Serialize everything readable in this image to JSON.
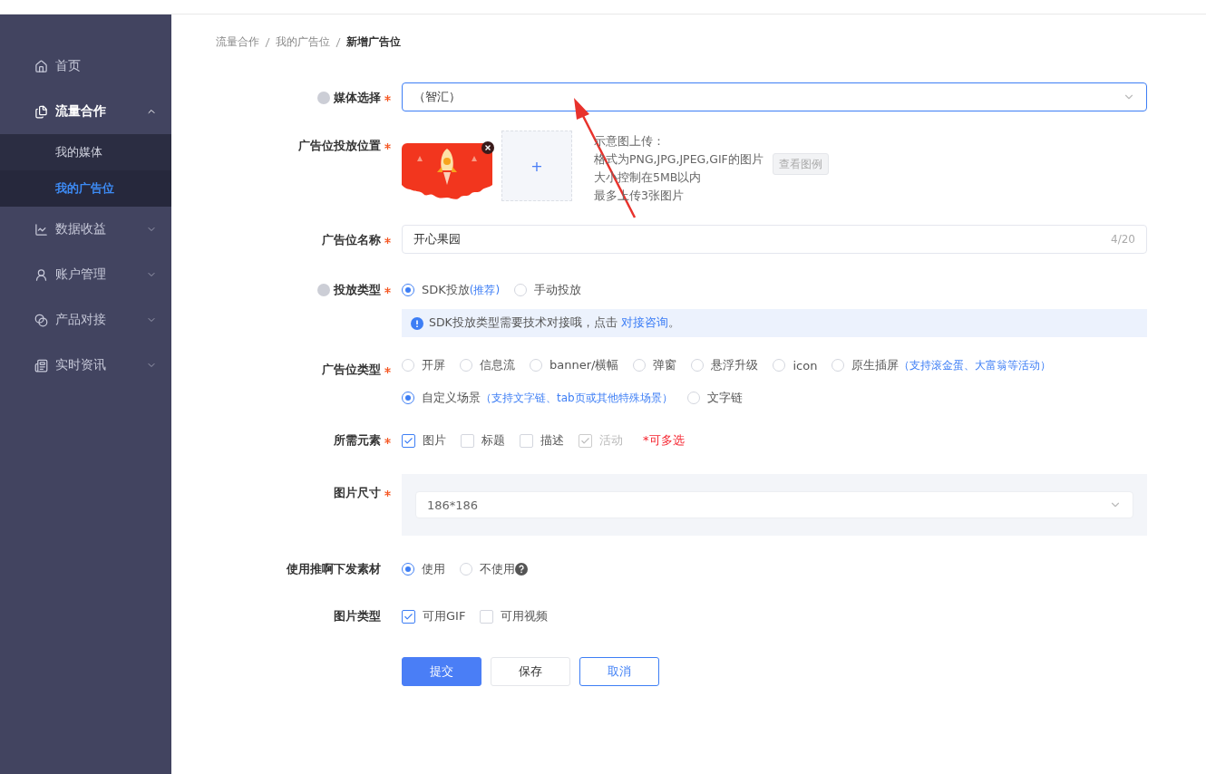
{
  "sidebar": {
    "items": [
      {
        "label": "首页",
        "kind": "link"
      },
      {
        "label": "流量合作",
        "kind": "group",
        "expanded": true,
        "children": [
          {
            "label": "我的媒体",
            "selected": false
          },
          {
            "label": "我的广告位",
            "selected": true
          }
        ]
      },
      {
        "label": "数据收益",
        "kind": "group",
        "expanded": false
      },
      {
        "label": "账户管理",
        "kind": "group",
        "expanded": false
      },
      {
        "label": "产品对接",
        "kind": "group",
        "expanded": false
      },
      {
        "label": "实时资讯",
        "kind": "group",
        "expanded": false
      }
    ]
  },
  "breadcrumb": [
    {
      "label": "流量合作",
      "current": false
    },
    {
      "label": "我的广告位",
      "current": false
    },
    {
      "label": "新增广告位",
      "current": true
    }
  ],
  "form": {
    "fields": [
      {
        "kind": "select",
        "label": "媒体选择",
        "required": true,
        "help": true,
        "value": "（智汇）"
      },
      {
        "kind": "upload",
        "label": "广告位投放位置",
        "required": true,
        "help": false,
        "upload_symbol": "+",
        "hint_lines": [
          "示意图上传：",
          "格式为PNG,JPG,JPEG,GIF的图片",
          "大小控制在5MB以内",
          "最多上传3张图片"
        ],
        "example_button": "查看图例"
      },
      {
        "kind": "text",
        "label": "广告位名称",
        "required": true,
        "help": false,
        "value": "开心果园",
        "counter": "4/20"
      },
      {
        "kind": "radio",
        "label": "投放类型",
        "required": true,
        "help": true,
        "option_rows": [
          [
            {
              "label": "SDK投放",
              "note": "(推荐)",
              "selected": true,
              "help": false
            },
            {
              "label": "手动投放",
              "selected": false,
              "help": false
            }
          ]
        ],
        "alert": {
          "text": "SDK投放类型需要技术对接哦，点击",
          "link": "对接咨询",
          "end": "。"
        }
      },
      {
        "kind": "radio",
        "label": "广告位类型",
        "required": true,
        "help": false,
        "option_rows": [
          [
            {
              "label": "开屏",
              "selected": false,
              "help": false
            },
            {
              "label": "信息流",
              "selected": false,
              "help": false
            },
            {
              "label": "banner/横幅",
              "selected": false,
              "help": false
            },
            {
              "label": "弹窗",
              "selected": false,
              "help": false
            },
            {
              "label": "悬浮升级",
              "selected": false,
              "help": false
            },
            {
              "label": "icon",
              "selected": false,
              "help": false
            },
            {
              "label": "原生插屏",
              "note": "（支持滚金蛋、大富翁等活动）",
              "selected": false,
              "help": false
            }
          ],
          [
            {
              "label": "自定义场景",
              "note": "（支持文字链、tab页或其他特殊场景）",
              "selected": true,
              "help": false
            },
            {
              "label": "文字链",
              "selected": false,
              "help": false
            }
          ]
        ]
      },
      {
        "kind": "checkbox",
        "label": "所需元素",
        "required": true,
        "help": false,
        "options": [
          {
            "label": "图片",
            "checked": true,
            "disabled": false
          },
          {
            "label": "标题",
            "checked": false,
            "disabled": false
          },
          {
            "label": "描述",
            "checked": false,
            "disabled": false
          },
          {
            "label": "活动",
            "checked": true,
            "disabled": true
          }
        ],
        "note": "*可多选"
      },
      {
        "kind": "size",
        "label": "图片尺寸",
        "required": true,
        "help": false,
        "value": "186*186"
      },
      {
        "kind": "radio",
        "label": "使用推啊下发素材",
        "required": false,
        "help": false,
        "option_rows": [
          [
            {
              "label": "使用",
              "selected": true,
              "help": false
            },
            {
              "label": "不使用",
              "selected": false,
              "help": true
            }
          ]
        ]
      },
      {
        "kind": "checkbox",
        "label": "图片类型",
        "required": false,
        "help": false,
        "options": [
          {
            "label": "可用GIF",
            "checked": true,
            "disabled": false
          },
          {
            "label": "可用视频",
            "checked": false,
            "disabled": false
          }
        ]
      }
    ]
  },
  "buttons": [
    {
      "label": "提交",
      "kind": "primary"
    },
    {
      "label": "保存",
      "kind": "default"
    },
    {
      "label": "取消",
      "kind": "outline"
    }
  ]
}
